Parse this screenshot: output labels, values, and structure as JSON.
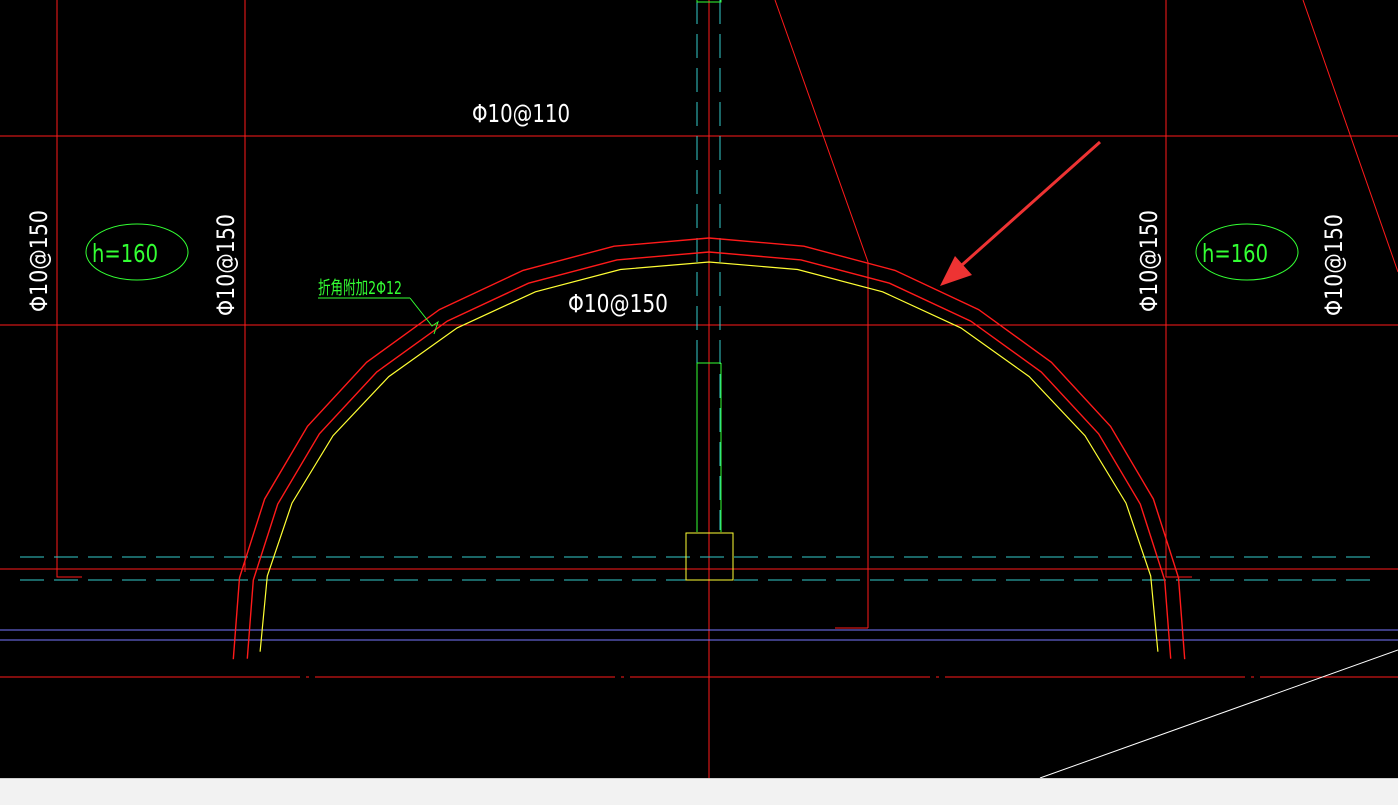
{
  "drawing": {
    "background": "#000000",
    "colors": {
      "grid_red": "#ff1a1a",
      "arc_yellow": "#ffff33",
      "text_white": "#ffffff",
      "label_green": "#33ff33",
      "axis_cyan": "#33cccc",
      "edge_blue": "#7777ff",
      "arrow_red": "#ee3333"
    },
    "labels": {
      "top_rebar": "Φ10@110",
      "arc_rebar": "Φ10@150",
      "left_rebar_outer": "Φ10@150",
      "left_rebar_inner": "Φ10@150",
      "right_rebar_inner": "Φ10@150",
      "right_rebar_outer": "Φ10@150",
      "corner_note": "折角附加2Φ12",
      "left_thickness": "h=160",
      "right_thickness": "h=160"
    },
    "icons": {
      "pointer": "red-arrow-icon"
    }
  }
}
